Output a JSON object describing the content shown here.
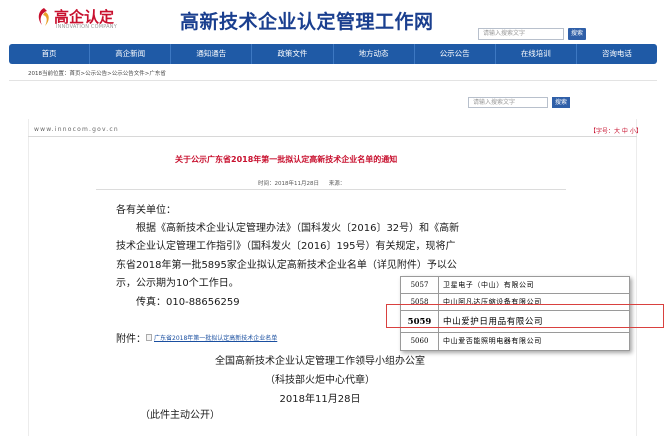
{
  "header": {
    "logo_text": "高企认定",
    "logo_sub": "INNOVATION COMPANY",
    "site_title": "高新技术企业认定管理工作网",
    "search_placeholder": "请输入搜索文字",
    "search_button": "搜索"
  },
  "nav": {
    "items": [
      "首页",
      "高企新闻",
      "通知通告",
      "政策文件",
      "地方动态",
      "公示公告",
      "在线培训",
      "咨询电话"
    ]
  },
  "breadcrumb": "2018当前位置：首页>公示公告>公示公告文件>广东省",
  "side_search": {
    "placeholder": "请输入搜索文字",
    "button": "搜索"
  },
  "article": {
    "site_url": "www.innocom.gov.cn",
    "font_size": "【字号：大 中 小】",
    "title": "关于公示广东省2018年第一批拟认定高新技术企业名单的通知",
    "time": "时间：2018年11月28日",
    "source": "来源：",
    "salutation": "各有关单位：",
    "para_lines": [
      "根据《高新技术企业认定管理办法》（国科发火〔2016〕32号）和《高新",
      "技术企业认定管理工作指引》（国科发火〔2016〕195号）有关规定，现将广",
      "东省2018年第一批5895家企业拟认定高新技术企业名单（详见附件）予以公",
      "示，公示期为10个工作日。"
    ],
    "fax": "传真：010-88656259",
    "attachment_label": "附件：",
    "attachment_link": "广东省2018年第一批拟认定高新技术企业名单",
    "signature_org": "全国高新技术企业认定管理工作领导小组办公室",
    "signature_sub": "（科技部火炬中心代章）",
    "signature_date": "2018年11月28日",
    "note": "（此件主动公开）"
  },
  "overlay_table": [
    {
      "no": "5057",
      "name": "卫星电子（中山）有限公司"
    },
    {
      "no": "5058",
      "name": "中山阿凡达压缩设备有限公司"
    },
    {
      "no": "5059",
      "name": "中山爱护日用品有限公司"
    },
    {
      "no": "5060",
      "name": "中山爱否能照明电器有限公司"
    }
  ],
  "highlight_row": 2,
  "colors": {
    "nav": "#1f5aa6",
    "title": "#c8102e",
    "highlight": "#d9413f"
  }
}
